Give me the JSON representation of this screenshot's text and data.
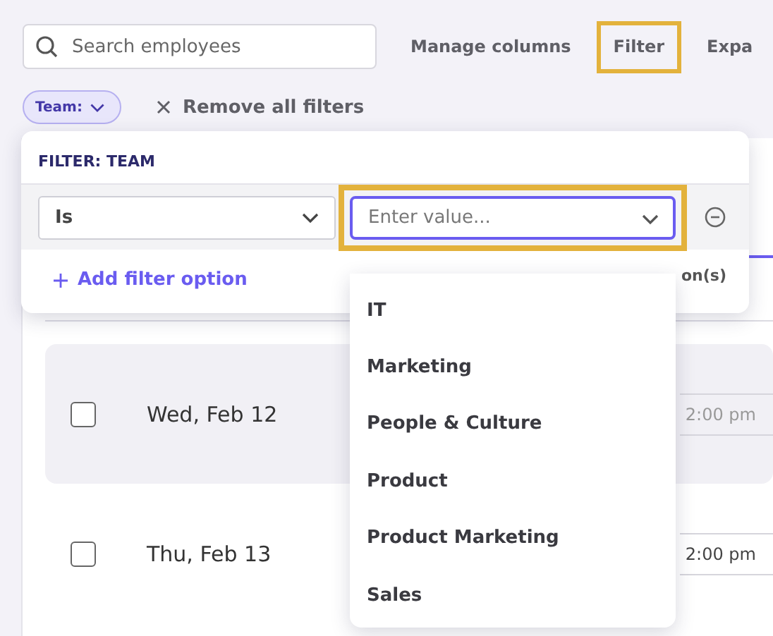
{
  "toolbar": {
    "search": {
      "placeholder": "Search employees"
    },
    "buttons": [
      {
        "label": "Manage columns",
        "highlighted": false
      },
      {
        "label": "Filter",
        "highlighted": true
      },
      {
        "label": "Expa",
        "highlighted": false
      }
    ]
  },
  "active_filters": {
    "chips": [
      {
        "label": "Team:"
      }
    ],
    "remove_all": "Remove all filters"
  },
  "table": {
    "header_text": "on(s)",
    "rows": [
      {
        "date": "Wed, Feb 12",
        "time": "2:00 pm",
        "checked": false,
        "hovered": true
      },
      {
        "date": "Thu, Feb 13",
        "time": "2:00 pm",
        "checked": false,
        "hovered": false
      }
    ]
  },
  "filter_popup": {
    "title": "FILTER: TEAM",
    "operator": "Is",
    "value_field": {
      "placeholder": "Enter value...",
      "highlighted": true
    },
    "add_option": "Add filter option"
  },
  "value_options": [
    {
      "label": "IT"
    },
    {
      "label": "Marketing"
    },
    {
      "label": "People & Culture"
    },
    {
      "label": "Product"
    },
    {
      "label": "Product Marketing"
    },
    {
      "label": "Sales"
    }
  ]
}
